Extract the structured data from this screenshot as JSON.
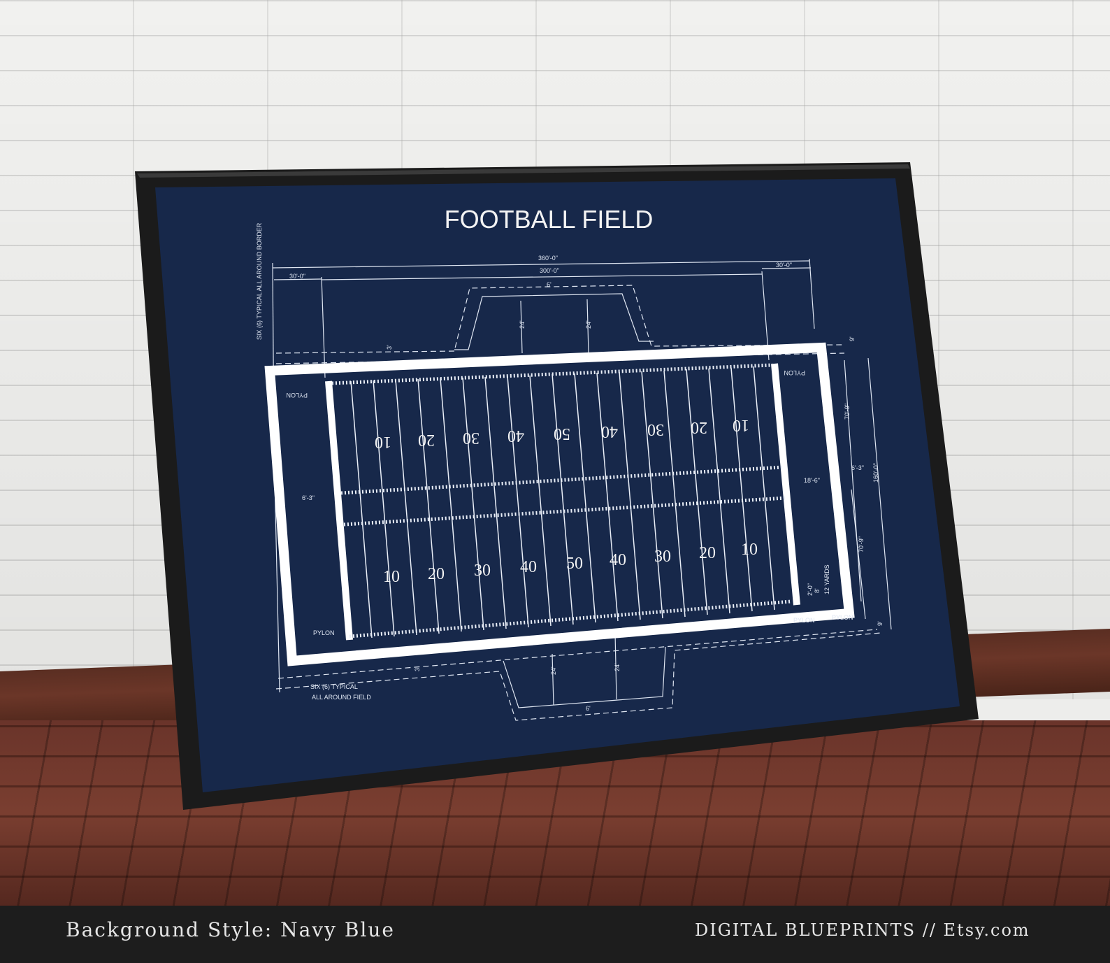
{
  "poster": {
    "title": "FOOTBALL FIELD",
    "dim_total": "360'-0\"",
    "dim_field": "300'-0\"",
    "dim_endzone_left": "30'-0\"",
    "dim_endzone_right": "30'-0\"",
    "dim_six": "6'",
    "dim_24": "24'",
    "dim_3": "3'",
    "dim_9": "9'",
    "dim_70_9": "70'-9\"",
    "dim_160": "160'-0\"",
    "dim_6_3": "6'-3\"",
    "dim_18_6": "18'-6\"",
    "dim_2_0": "2'-0\"",
    "dim_8": "8'",
    "dim_12_yards": "12 YARDS",
    "pylon": "PYLON",
    "typical_border": "SIX (6) TYPICAL ALL AROUND BORDER",
    "typical_field_1": "SIX (6) TYPICAL",
    "typical_field_2": "ALL AROUND FIELD",
    "yard_numbers": [
      "10",
      "20",
      "30",
      "40",
      "50",
      "40",
      "30",
      "20",
      "10"
    ]
  },
  "footer": {
    "left": "Background Style: Navy Blue",
    "right": "DIGITAL BLUEPRINTS // Etsy.com"
  },
  "colors": {
    "navy": "#17284a",
    "frame": "#1a1a1a",
    "line": "#ffffff"
  }
}
